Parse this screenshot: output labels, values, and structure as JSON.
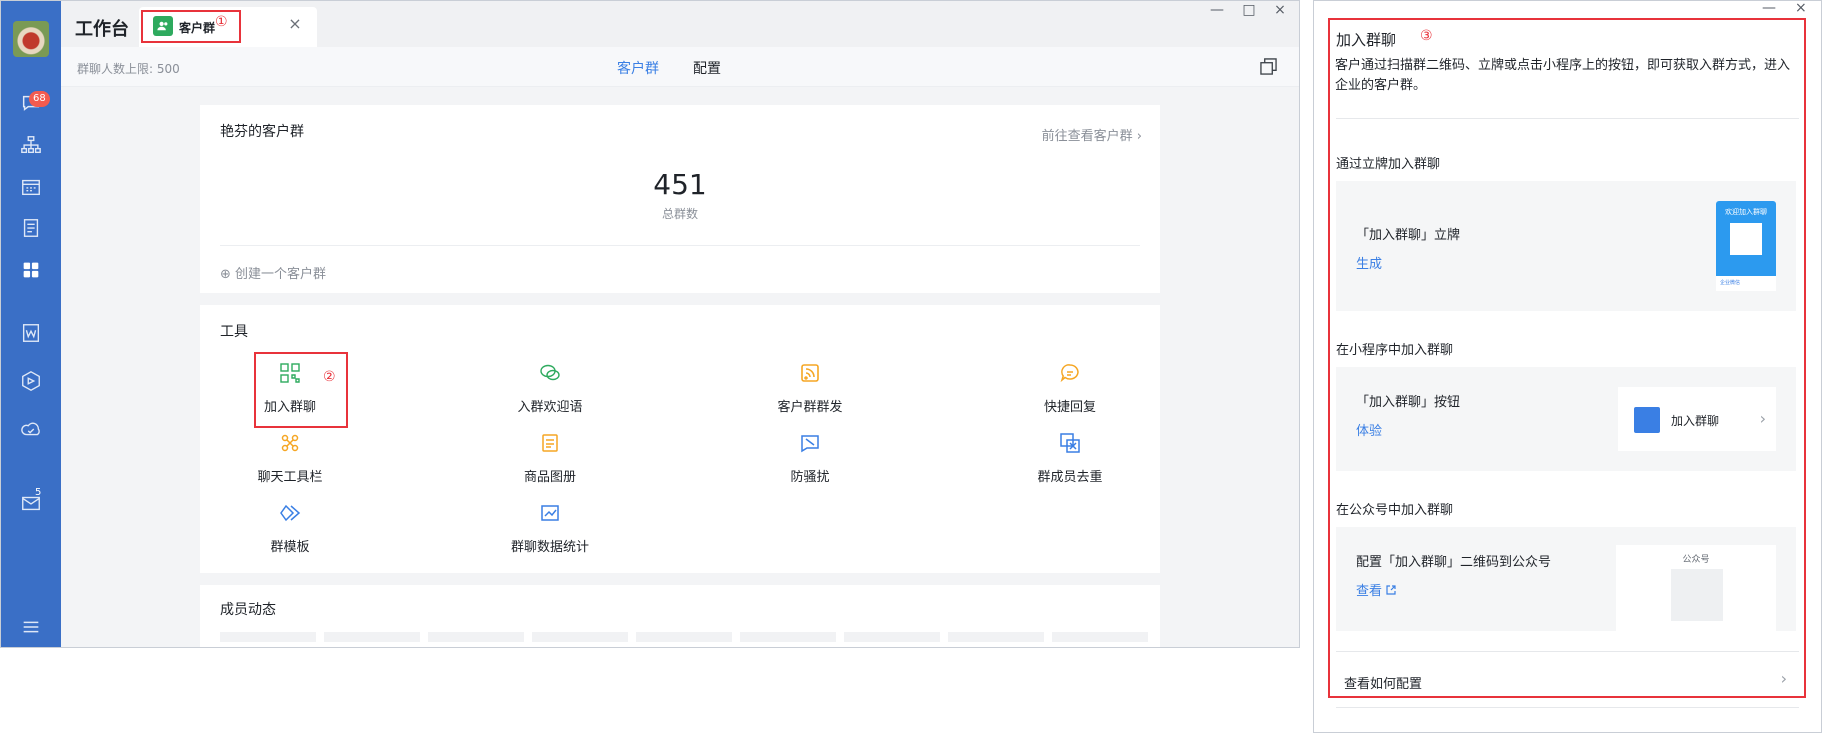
{
  "main_window": {
    "app_title": "工作台",
    "tab": {
      "label": "客户群",
      "marker": "①",
      "close": "×"
    },
    "sidebar": {
      "message_badge": "68",
      "mail_badge": "5",
      "icons": [
        "avatar",
        "chat-icon",
        "org-chart-icon",
        "calendar-icon",
        "document-icon",
        "workbench-icon",
        "doc-w-icon",
        "hexagon-icon",
        "cloud-icon",
        "mail-icon",
        "menu-icon"
      ]
    },
    "window_controls": {
      "minimize": "—",
      "maximize": "□",
      "close": "×"
    },
    "sub_bar": {
      "member_limit": "群聊人数上限: 500",
      "tabs": [
        {
          "label": "客户群",
          "active": true
        },
        {
          "label": "配置",
          "active": false
        }
      ]
    },
    "group_card": {
      "title": "艳芬的客户群",
      "view_link": "前往查看客户群",
      "arrow": "›",
      "total_number": "451",
      "total_label": "总群数",
      "create_link": "⊕ 创建一个客户群"
    },
    "tools_card": {
      "title": "工具",
      "highlight_marker": "②",
      "tools": [
        {
          "label": "加入群聊",
          "icon": "qrcode-icon"
        },
        {
          "label": "入群欢迎语",
          "icon": "wechat-bubble-icon"
        },
        {
          "label": "客户群群发",
          "icon": "broadcast-icon"
        },
        {
          "label": "快捷回复",
          "icon": "quick-reply-icon"
        },
        {
          "label": "聊天工具栏",
          "icon": "toolbar-icon"
        },
        {
          "label": "商品图册",
          "icon": "catalog-icon"
        },
        {
          "label": "防骚扰",
          "icon": "shield-flag-icon"
        },
        {
          "label": "群成员去重",
          "icon": "dedupe-icon"
        },
        {
          "label": "群模板",
          "icon": "template-icon"
        },
        {
          "label": "群聊数据统计",
          "icon": "stats-icon"
        }
      ]
    },
    "member_card": {
      "title": "成员动态"
    }
  },
  "side_panel": {
    "window_controls": {
      "minimize": "—",
      "close": "×"
    },
    "title": "加入群聊",
    "marker": "③",
    "description": "客户通过扫描群二维码、立牌或点击小程序上的按钮，即可获取入群方式，进入企业的客户群。",
    "sections": [
      {
        "heading": "通过立牌加入群聊",
        "name": "「加入群聊」立牌",
        "link": "生成",
        "preview": {
          "banner": "欢迎加入群聊",
          "footer": "企业微信"
        }
      },
      {
        "heading": "在小程序中加入群聊",
        "name": "「加入群聊」按钮",
        "link": "体验",
        "preview": {
          "button_label": "加入群聊",
          "arrow": "›"
        }
      },
      {
        "heading": "在公众号中加入群聊",
        "name": "配置「加入群聊」二维码到公众号",
        "link": "查看",
        "preview": {
          "label": "公众号"
        }
      }
    ],
    "footer_link": "查看如何配置",
    "footer_arrow": "›"
  },
  "colors": {
    "sidebar": "#3a6fc6",
    "accent_blue": "#3a7fe4",
    "highlight_red": "#e8333b",
    "tab_green": "#2eaa5e",
    "tool_green": "#2eaa5e",
    "tool_orange": "#f5a623",
    "tool_blue": "#3a7fe4"
  }
}
